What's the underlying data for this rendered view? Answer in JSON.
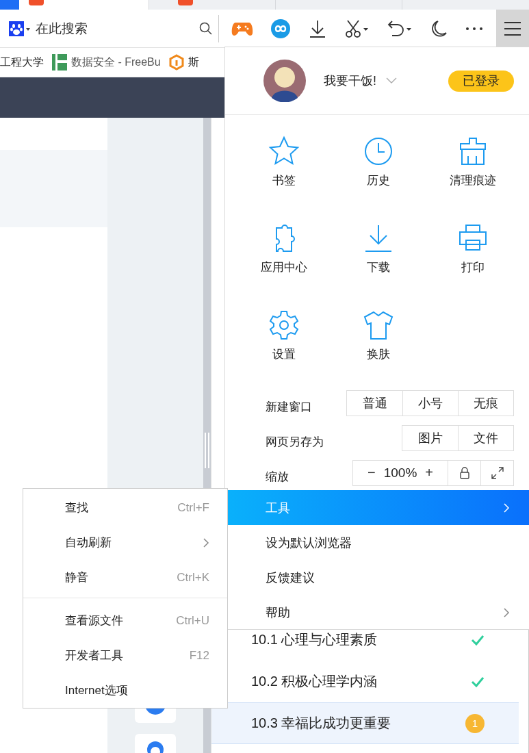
{
  "tabs": [
    {
      "selected": true
    },
    {
      "selected": false
    },
    {
      "selected": false
    }
  ],
  "toolbar": {
    "search": {
      "placeholder": "在此搜索"
    }
  },
  "bookmarks": [
    {
      "label": "工程大学",
      "kind": "plain"
    },
    {
      "label": "数据安全 - FreeBu",
      "kind": "bars"
    },
    {
      "label": "斯",
      "kind": "hex"
    }
  ],
  "account": {
    "name": "我要干饭!",
    "status": "已登录"
  },
  "grid": [
    {
      "label": "书签",
      "kind": "star"
    },
    {
      "label": "历史",
      "kind": "clock"
    },
    {
      "label": "清理痕迹",
      "kind": "broom"
    },
    {
      "label": "应用中心",
      "kind": "puzzle"
    },
    {
      "label": "下载",
      "kind": "download"
    },
    {
      "label": "打印",
      "kind": "printer"
    },
    {
      "label": "设置",
      "kind": "gear"
    },
    {
      "label": "换肤",
      "kind": "shirt"
    }
  ],
  "new_window": {
    "label": "新建窗口",
    "options": [
      "普通",
      "小号",
      "无痕"
    ]
  },
  "save_as": {
    "label": "网页另存为",
    "options": [
      "图片",
      "文件"
    ]
  },
  "zoom": {
    "label": "缩放",
    "minus": "−",
    "value": "100%",
    "plus": "+"
  },
  "menu_items": [
    {
      "label": "工具",
      "selected": true,
      "submenu": true
    },
    {
      "label": "设为默认浏览器",
      "selected": false,
      "submenu": false
    },
    {
      "label": "反馈建议",
      "selected": false,
      "submenu": false
    },
    {
      "label": "帮助",
      "selected": false,
      "submenu": true
    }
  ],
  "tools_submenu": [
    [
      {
        "label": "查找",
        "shortcut": "Ctrl+F",
        "submenu": false
      },
      {
        "label": "自动刷新",
        "submenu": true
      },
      {
        "label": "静音",
        "shortcut": "Ctrl+K",
        "submenu": false
      }
    ],
    [
      {
        "label": "查看源文件",
        "shortcut": "Ctrl+U",
        "submenu": false
      },
      {
        "label": "开发者工具",
        "shortcut": "F12",
        "submenu": false
      },
      {
        "label": "Internet选项",
        "submenu": false
      }
    ]
  ],
  "lessons": [
    {
      "title": "10.1 心理与心理素质",
      "done": true,
      "selected": false
    },
    {
      "title": "10.2 积极心理学内涵",
      "done": true,
      "selected": false
    },
    {
      "title": "10.3 幸福比成功更重要",
      "done": false,
      "badge": "1",
      "selected": true
    }
  ]
}
